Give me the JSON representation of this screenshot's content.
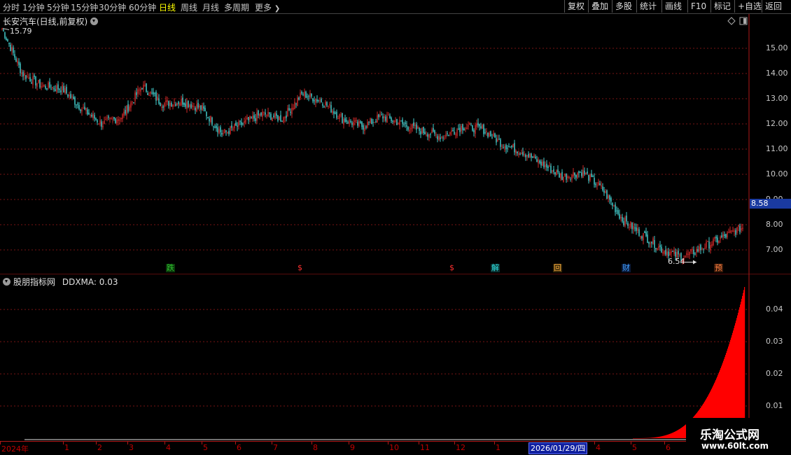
{
  "toolbar": {
    "periods": [
      "分时",
      "1分钟",
      "5分钟",
      "15分钟",
      "30分钟",
      "60分钟",
      "日线",
      "周线",
      "月线",
      "多周期",
      "更多"
    ],
    "active_period": "日线",
    "right_buttons": [
      "复权",
      "叠加",
      "多股",
      "统计",
      "画线",
      "F10",
      "标记",
      "+自选",
      "返回"
    ]
  },
  "main_chart": {
    "title": "长安汽车(日线,前复权)",
    "current_price_tag": "8.58",
    "high_label": "15.79",
    "low_label": "6.54",
    "y_axis": [
      "15.00",
      "14.00",
      "13.00",
      "12.00",
      "11.00",
      "10.00",
      "9.00",
      "8.00",
      "7.00"
    ],
    "event_markers": [
      {
        "text": "跌",
        "color": "#30c030",
        "bg": "#0a3a0a"
      },
      {
        "text": "$",
        "color": "#ff3030",
        "bg": "#000000"
      },
      {
        "text": "$",
        "color": "#ff3030",
        "bg": "#000000"
      },
      {
        "text": "解",
        "color": "#30e0e0",
        "bg": "#0a3030"
      },
      {
        "text": "回",
        "color": "#ffb040",
        "bg": "#3a2a0a"
      },
      {
        "text": "财",
        "color": "#40a0ff",
        "bg": "#0a1a3a"
      },
      {
        "text": "预",
        "color": "#ff8040",
        "bg": "#3a1a0a"
      }
    ]
  },
  "indicator": {
    "title": "股朋指标网",
    "value_label": "DDXMA: 0.03",
    "y_axis": [
      "0.04",
      "0.03",
      "0.02",
      "0.01"
    ]
  },
  "date_axis": {
    "labels": [
      "2024年",
      "1",
      "2",
      "3",
      "4",
      "5",
      "6",
      "7",
      "8",
      "9",
      "10",
      "11",
      "12",
      "1",
      "4",
      "5",
      "6"
    ],
    "cursor_date": "2026/01/29/四"
  },
  "watermark": {
    "title": "乐淘公式网",
    "url": "www.60lt.com"
  },
  "colors": {
    "up": "#ff3232",
    "down": "#54ffff",
    "grid": "#781414",
    "accent_blue": "#1a3aa0",
    "indicator_bar": "#ff0000"
  },
  "chart_data": {
    "type": "candlestick",
    "price_range": [
      6.54,
      15.79
    ],
    "price_path_keypoints": [
      15.79,
      14.0,
      13.5,
      13.4,
      12.6,
      12.0,
      12.3,
      13.5,
      12.8,
      12.9,
      12.6,
      11.6,
      12.0,
      12.4,
      12.2,
      13.2,
      12.9,
      12.2,
      11.9,
      12.3,
      12.0,
      11.7,
      11.5,
      11.9,
      11.8,
      11.2,
      10.9,
      10.4,
      9.9,
      10.1,
      9.4,
      8.2,
      7.6,
      7.0,
      6.7,
      7.1,
      7.5,
      7.9
    ],
    "indicator_series": "DDXMA",
    "indicator_range": [
      0,
      0.047
    ]
  }
}
